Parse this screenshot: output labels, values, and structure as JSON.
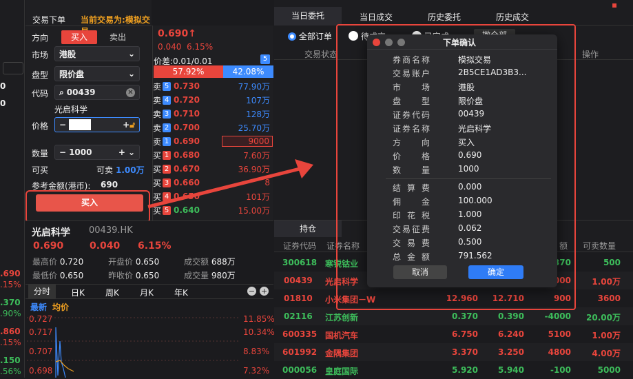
{
  "left_edge": {
    "values": [
      "0",
      "0",
      ".690",
      ".15%",
      ".370",
      ".90%",
      ".860",
      ".15%",
      ".150",
      ".56%"
    ]
  },
  "order_panel": {
    "title": "交易下单",
    "current_label": "当前交易为:",
    "current_value": "模拟交易",
    "direction_label": "方向",
    "buy_tab": "买入",
    "sell_tab": "卖出",
    "market_label": "市场",
    "market_value": "港股",
    "type_label": "盘型",
    "type_value": "限价盘",
    "code_label": "代码",
    "code_value": "00439",
    "stock_name": "光启科学",
    "price_label": "价格",
    "qty_label": "数量",
    "qty_value": "1000",
    "buyable_label": "可买",
    "sellable_label": "可卖",
    "sellable_value": "1.00万",
    "ref_amount_label": "参考金额(港币):",
    "ref_amount_value": "690",
    "buy_button": "买入"
  },
  "quote": {
    "price": "0.690",
    "arrow": "↑",
    "change": "0.040",
    "pct": "6.15%",
    "spread": "价差:0.01/0.01",
    "level_badge": "5",
    "bid_ratio": "57.92%",
    "ask_ratio": "42.08%"
  },
  "orderbook": {
    "asks": [
      {
        "label": "卖",
        "lvl": "5",
        "price": "0.730",
        "vol": "77.90万"
      },
      {
        "label": "卖",
        "lvl": "4",
        "price": "0.720",
        "vol": "107万"
      },
      {
        "label": "卖",
        "lvl": "3",
        "price": "0.710",
        "vol": "128万"
      },
      {
        "label": "卖",
        "lvl": "2",
        "price": "0.700",
        "vol": "25.70万"
      },
      {
        "label": "卖",
        "lvl": "1",
        "price": "0.690",
        "vol": "9000"
      }
    ],
    "bids": [
      {
        "label": "买",
        "lvl": "1",
        "price": "0.680",
        "vol": "7.60万"
      },
      {
        "label": "买",
        "lvl": "2",
        "price": "0.670",
        "vol": "36.90万"
      },
      {
        "label": "买",
        "lvl": "3",
        "price": "0.660",
        "vol": "8"
      },
      {
        "label": "买",
        "lvl": "4",
        "price": "0.650",
        "vol": "101万"
      },
      {
        "label": "买",
        "lvl": "5",
        "price": "0.640",
        "vol": "15.00万"
      }
    ]
  },
  "stock_info": {
    "name": "光启科学",
    "code": "00439.HK",
    "price": "0.690",
    "change": "0.040",
    "pct": "6.15%",
    "high_label": "最高价",
    "high": "0.720",
    "open_label": "开盘价",
    "open": "0.650",
    "vol_label": "成交额",
    "vol": "688万",
    "low_label": "最低价",
    "low": "0.650",
    "prev_label": "昨收价",
    "prev": "0.650",
    "qty_label": "成交量",
    "qty": "980万"
  },
  "chart_tabs": [
    "分时",
    "日K",
    "周K",
    "月K",
    "年K"
  ],
  "chart": {
    "legend_latest": "最新",
    "legend_avg": "均价",
    "left_ticks": [
      "0.727",
      "0.717",
      "0.707",
      "0.698"
    ],
    "right_ticks": [
      "11.85%",
      "10.34%",
      "8.83%",
      "7.32%"
    ]
  },
  "top_tabs": [
    "当日委托",
    "当日成交",
    "历史委托",
    "历史成交"
  ],
  "filters": {
    "all": "全部订单",
    "pending": "待成交",
    "done": "已完成",
    "btn": "撤全部"
  },
  "order_cols": {
    "status": "交易状态",
    "action": "操作"
  },
  "holdings_tab": "持仓",
  "holdings_cols": [
    "证券代码",
    "证券名称",
    "额",
    "可卖数量"
  ],
  "holdings": [
    {
      "code": "300618",
      "name": "寒锐钴业",
      "c3": "",
      "c4": "",
      "c5": "370",
      "c6": "500",
      "color": "green"
    },
    {
      "code": "00439",
      "name": "光启科学",
      "c3": "",
      "c4": "",
      "c5": "000",
      "c6": "1.00万",
      "color": "red"
    },
    {
      "code": "01810",
      "name": "小米集团－W",
      "c3": "12.960",
      "c4": "12.710",
      "c5": "900",
      "c6": "3600",
      "color": "red"
    },
    {
      "code": "02116",
      "name": "江苏创新",
      "c3": "0.370",
      "c4": "0.390",
      "c5": "-4000",
      "c6": "20.00万",
      "color": "green"
    },
    {
      "code": "600335",
      "name": "国机汽车",
      "c3": "6.750",
      "c4": "6.240",
      "c5": "5100",
      "c6": "1.00万",
      "color": "red"
    },
    {
      "code": "601992",
      "name": "金隅集团",
      "c3": "3.370",
      "c4": "3.250",
      "c5": "4800",
      "c6": "4.00万",
      "color": "red"
    },
    {
      "code": "000056",
      "name": "皇庭国际",
      "c3": "5.920",
      "c4": "5.940",
      "c5": "-100",
      "c6": "5000",
      "color": "green"
    }
  ],
  "dialog": {
    "title": "下单确认",
    "rows": [
      {
        "k": "券商名称",
        "v": "模拟交易"
      },
      {
        "k": "交易账户",
        "v": "2B5CE1AD3B3..."
      },
      {
        "k": "市场",
        "v": "港股"
      },
      {
        "k": "盘型",
        "v": "限价盘"
      },
      {
        "k": "证券代码",
        "v": "00439"
      },
      {
        "k": "证券名称",
        "v": "光启科学"
      },
      {
        "k": "方向",
        "v": "买入"
      },
      {
        "k": "价格",
        "v": "0.690"
      },
      {
        "k": "数量",
        "v": "1000"
      }
    ],
    "fees": [
      {
        "k": "结算费",
        "v": "0.000"
      },
      {
        "k": "佣金",
        "v": "100.000"
      },
      {
        "k": "印花税",
        "v": "1.000"
      },
      {
        "k": "交易征费",
        "v": "0.062"
      },
      {
        "k": "交易费",
        "v": "0.500"
      },
      {
        "k": "总金额",
        "v": "791.562"
      }
    ],
    "cancel": "取消",
    "confirm": "确定"
  }
}
